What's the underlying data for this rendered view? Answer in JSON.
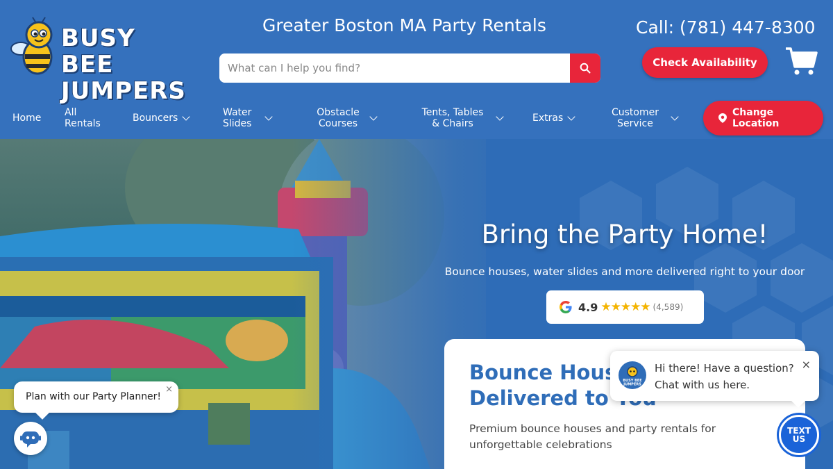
{
  "brand": {
    "name_line1": "BUSY BEE",
    "name_line2": "JUMPERS"
  },
  "header": {
    "tagline": "Greater Boston MA Party Rentals",
    "phone": "Call: (781) 447-8300",
    "search_placeholder": "What can I help you find?",
    "check_availability": "Check Availability"
  },
  "nav": {
    "items": [
      {
        "label": "Home"
      },
      {
        "label": "All Rentals"
      },
      {
        "label": "Bouncers"
      },
      {
        "label": "Water Slides"
      },
      {
        "label": "Obstacle Courses"
      },
      {
        "label": "Tents, Tables & Chairs"
      },
      {
        "label": "Extras"
      },
      {
        "label": "Customer Service"
      }
    ],
    "change_location": "Change Location"
  },
  "hero": {
    "title": "Bring the Party Home!",
    "subtitle": "Bounce houses, water slides and more delivered right to your door",
    "rating": {
      "score": "4.9",
      "stars": "★★★★★",
      "count": "(4,589)"
    }
  },
  "card": {
    "title": "Bounce Houses Delivered to You",
    "text": "Premium bounce houses and party rentals for unforgettable celebrations"
  },
  "planner": {
    "text": "Plan with our Party Planner!",
    "close": "×"
  },
  "chat": {
    "line1": "Hi there! Have a question?",
    "line2": "Chat with us here.",
    "close": "×",
    "avatar_text": "BUSY BEE JUMPERS"
  },
  "text_us": {
    "line1": "TEXT",
    "line2": "US"
  },
  "colors": {
    "primary_blue": "#3571bd",
    "accent_red": "#e8253a",
    "star_gold": "#f4b400"
  }
}
